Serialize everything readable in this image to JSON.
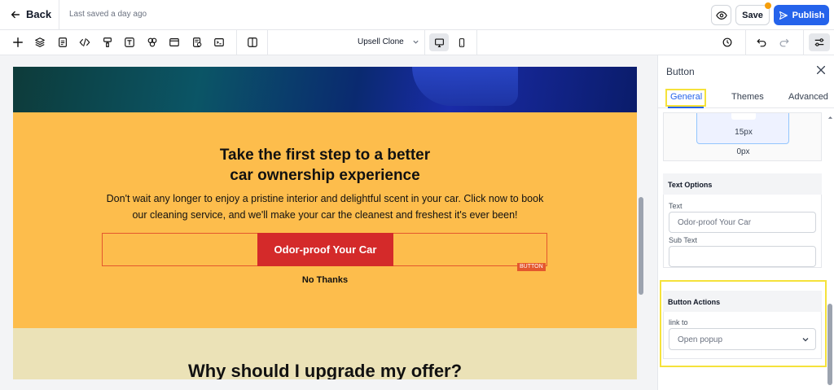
{
  "topbar": {
    "back_label": "Back",
    "saved_status": "Last saved a day ago",
    "save_label": "Save",
    "publish_label": "Publish"
  },
  "toolbar": {
    "page_name": "Upsell Clone",
    "icons": [
      "plus-icon",
      "layers-icon",
      "page-icon",
      "code-icon",
      "paint-icon",
      "text-icon",
      "shapes-icon",
      "layout-icon",
      "form-icon",
      "terminal-icon",
      "split-view-icon"
    ]
  },
  "canvas": {
    "cta_title_line1": "Take the first step to a better",
    "cta_title_line2": "car ownership experience",
    "cta_desc_line1": "Don't wait any longer to enjoy a pristine interior and delightful scent in your car. Click now to book",
    "cta_desc_line2": "our cleaning service, and we'll make your car the cleanest and freshest it's ever been!",
    "cta_button": "Odor-proof Your Car",
    "button_tag": "BUTTON",
    "no_thanks": "No Thanks",
    "why_title": "Why should I upgrade my offer?",
    "colors": {
      "cta_bg": "#fdbd4c",
      "button_bg": "#d42a2a",
      "why_bg": "#ebe2b7"
    }
  },
  "panel": {
    "title": "Button",
    "tabs": [
      "General",
      "Themes",
      "Advanced"
    ],
    "active_tab": "General",
    "spacing_inner": "15px",
    "spacing_outer": "0px",
    "text_options": {
      "header": "Text Options",
      "text_label": "Text",
      "text_value": "Odor-proof Your Car",
      "subtext_label": "Sub Text",
      "subtext_value": ""
    },
    "button_actions": {
      "header": "Button Actions",
      "link_label": "link to",
      "link_value": "Open popup"
    }
  },
  "colors": {
    "accent": "#2563eb",
    "highlight": "#f5e23b",
    "save_indicator": "#f59e0b"
  }
}
